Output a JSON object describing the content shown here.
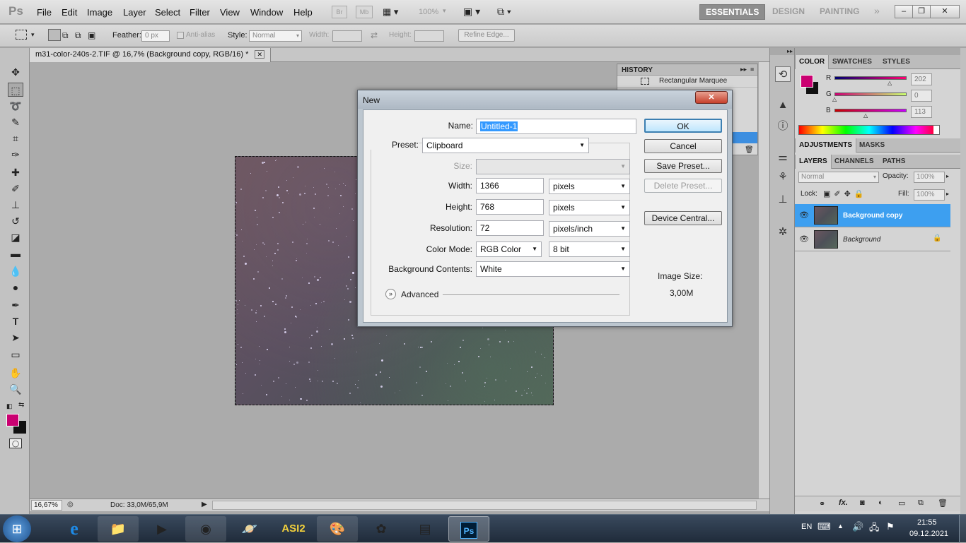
{
  "app": {
    "logo": "Ps"
  },
  "menu": [
    "File",
    "Edit",
    "Image",
    "Layer",
    "Select",
    "Filter",
    "View",
    "Window",
    "Help"
  ],
  "menubar": {
    "bridge_label": "Br",
    "minibridge_label": "Mb",
    "zoom": "100%"
  },
  "workspaces": [
    "ESSENTIALS",
    "DESIGN",
    "PAINTING"
  ],
  "options": {
    "feather_label": "Feather:",
    "feather_value": "0 px",
    "antialias_label": "Anti-alias",
    "style_label": "Style:",
    "style_value": "Normal",
    "width_label": "Width:",
    "height_label": "Height:",
    "refine_edge": "Refine Edge..."
  },
  "document": {
    "tab_title": "m31-color-240s-2.TIF @ 16,7% (Background copy, RGB/16) *"
  },
  "status": {
    "zoom": "16,67%",
    "doc": "Doc: 33,0M/65,9M"
  },
  "history": {
    "title": "HISTORY",
    "item": "Rectangular Marquee"
  },
  "color_panel": {
    "tabs": [
      "COLOR",
      "SWATCHES",
      "STYLES"
    ],
    "r_label": "R",
    "g_label": "G",
    "b_label": "B",
    "r": "202",
    "g": "0",
    "b": "113",
    "foreground": "#ca0071"
  },
  "adjust_tabs": [
    "ADJUSTMENTS",
    "MASKS"
  ],
  "layers_panel": {
    "tabs": [
      "LAYERS",
      "CHANNELS",
      "PATHS"
    ],
    "blend": "Normal",
    "opacity_label": "Opacity:",
    "opacity": "100%",
    "lock_label": "Lock:",
    "fill_label": "Fill:",
    "fill": "100%",
    "layers": [
      {
        "name": "Background copy",
        "selected": true
      },
      {
        "name": "Background",
        "selected": false
      }
    ]
  },
  "dialog": {
    "title": "New",
    "name_label": "Name:",
    "name_value": "Untitled-1",
    "preset_label": "Preset:",
    "preset_value": "Clipboard",
    "size_label": "Size:",
    "width_label": "Width:",
    "width_value": "1366",
    "width_unit": "pixels",
    "height_label": "Height:",
    "height_value": "768",
    "height_unit": "pixels",
    "resolution_label": "Resolution:",
    "resolution_value": "72",
    "resolution_unit": "pixels/inch",
    "color_mode_label": "Color Mode:",
    "color_mode_value": "RGB Color",
    "bit_depth": "8 bit",
    "bg_label": "Background Contents:",
    "bg_value": "White",
    "advanced": "Advanced",
    "ok": "OK",
    "cancel": "Cancel",
    "save_preset": "Save Preset...",
    "delete_preset": "Delete Preset...",
    "device_central": "Device Central...",
    "image_size_label": "Image Size:",
    "image_size_value": "3,00M"
  },
  "taskbar": {
    "lang": "EN",
    "time": "21:55",
    "date": "09.12.2021",
    "asi_label": "ASI2"
  }
}
